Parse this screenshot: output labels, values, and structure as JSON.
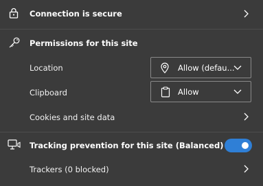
{
  "connection": {
    "label": "Connection is secure"
  },
  "permissions": {
    "heading": "Permissions for this site",
    "items": [
      {
        "label": "Location",
        "value": "Allow (defau..."
      },
      {
        "label": "Clipboard",
        "value": "Allow"
      }
    ],
    "cookies_label": "Cookies and site data"
  },
  "tracking": {
    "label": "Tracking prevention for this site (Balanced)",
    "enabled": true,
    "trackers_label": "Trackers (0 blocked)"
  },
  "colors": {
    "background": "#3b3b3b",
    "accent": "#2f7fd6",
    "divider": "#4d4d4d",
    "border": "#8a8a8a"
  },
  "icons": [
    "lock-icon",
    "key-icon",
    "location-pin-icon",
    "clipboard-icon",
    "tracking-icon",
    "chevron-right-icon",
    "chevron-down-icon"
  ]
}
